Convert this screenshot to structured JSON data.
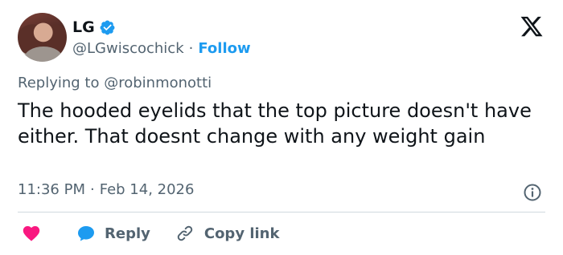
{
  "author": {
    "name": "LG",
    "handle": "@LGwiscochick",
    "separator": "·",
    "follow_label": "Follow"
  },
  "reply_context": {
    "prefix": "Replying to",
    "mention": "@robinmonotti"
  },
  "tweet": {
    "text": "The hooded eyelids that the top picture doesn't have either. That doesnt change with any weight gain",
    "time": "11:36 PM",
    "separator": "·",
    "date": "Feb 14, 2026"
  },
  "actions": {
    "reply_label": "Reply",
    "copy_link_label": "Copy link"
  },
  "icons": {
    "verified": "verified-badge-icon",
    "x_logo": "x-logo-icon",
    "info": "info-icon",
    "heart": "heart-icon",
    "reply": "reply-bubble-icon",
    "link": "link-icon"
  },
  "colors": {
    "accent": "#1d9bf0",
    "heart": "#f91880",
    "muted": "#536471",
    "text": "#0f1419",
    "divider": "#cfd9de"
  }
}
